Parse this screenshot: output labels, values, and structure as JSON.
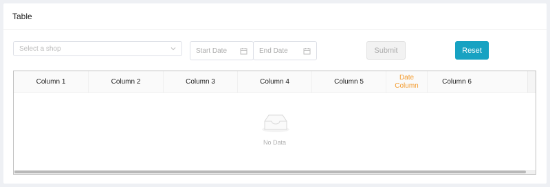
{
  "card": {
    "title": "Table"
  },
  "filters": {
    "shop_placeholder": "Select a shop",
    "start_date_placeholder": "Start Date",
    "end_date_placeholder": "End Date",
    "submit_label": "Submit",
    "reset_label": "Reset"
  },
  "table": {
    "columns": [
      "Column 1",
      "Column 2",
      "Column 3",
      "Column 4",
      "Column 5",
      "Date Column",
      "Column 6"
    ],
    "empty_text": "No Data"
  },
  "colors": {
    "accent": "#17a2c2",
    "date_column": "#f39a2c"
  }
}
